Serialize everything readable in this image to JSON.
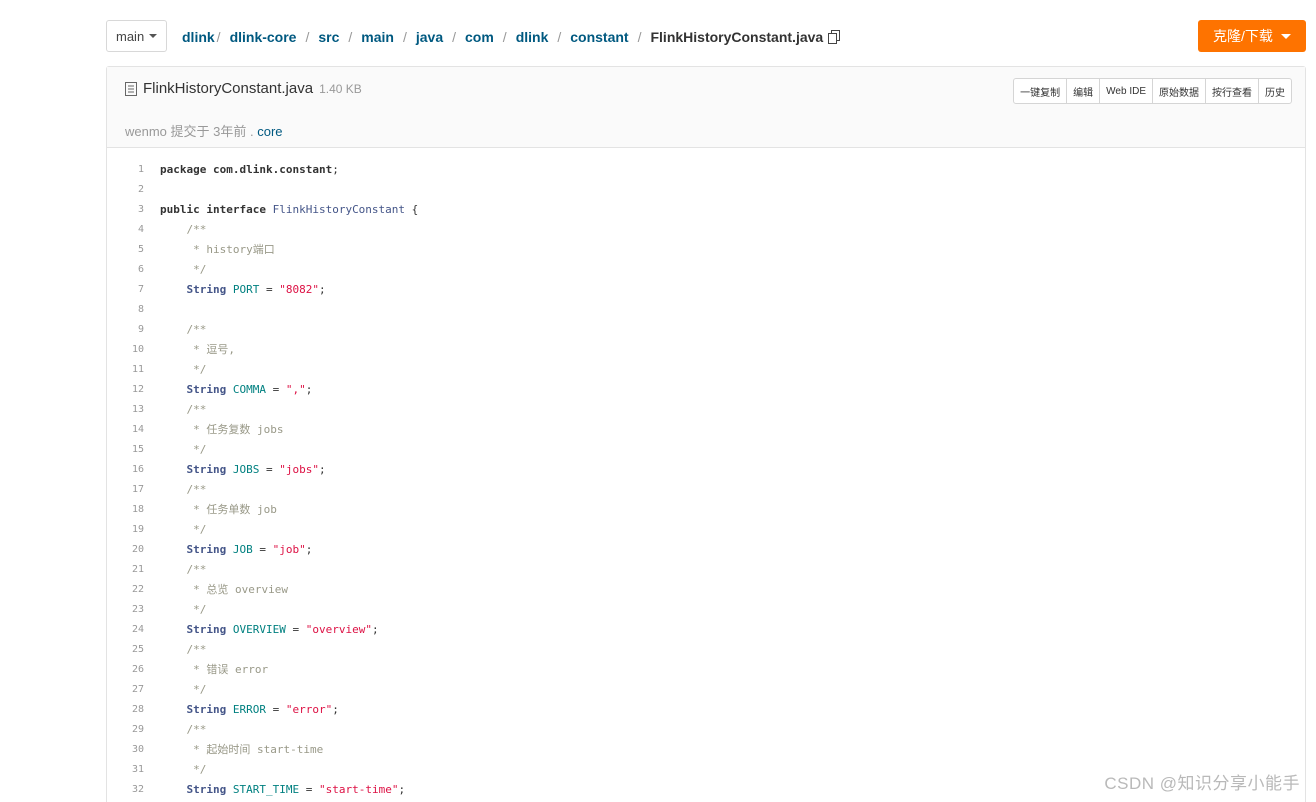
{
  "branch": {
    "label": "main"
  },
  "breadcrumb": [
    "dlink",
    "dlink-core",
    "src",
    "main",
    "java",
    "com",
    "dlink",
    "constant"
  ],
  "current_file": "FlinkHistoryConstant.java",
  "clone_button": "克隆/下载",
  "file": {
    "name": "FlinkHistoryConstant.java",
    "size": "1.40 KB",
    "commit_author": "wenmo",
    "commit_text": " 提交于 3年前 . ",
    "commit_branch": "core"
  },
  "actions": [
    "一键复制",
    "编辑",
    "Web IDE",
    "原始数据",
    "按行查看",
    "历史"
  ],
  "code_lines": [
    [
      [
        "kw",
        "package "
      ],
      [
        "kw",
        "com.dlink.constant"
      ],
      [
        "",
        "; "
      ]
    ],
    [],
    [
      [
        "kw",
        "public interface "
      ],
      [
        "cls",
        "FlinkHistoryConstant"
      ],
      [
        "",
        " {"
      ]
    ],
    [
      [
        "cm",
        "    /**"
      ]
    ],
    [
      [
        "cm",
        "     * history端口"
      ]
    ],
    [
      [
        "cm",
        "     */"
      ]
    ],
    [
      [
        "ty",
        "    String "
      ],
      [
        "id",
        "PORT"
      ],
      [
        "",
        " = "
      ],
      [
        "str",
        "\"8082\""
      ],
      [
        "",
        ";"
      ]
    ],
    [],
    [
      [
        "cm",
        "    /**"
      ]
    ],
    [
      [
        "cm",
        "     * 逗号,"
      ]
    ],
    [
      [
        "cm",
        "     */"
      ]
    ],
    [
      [
        "ty",
        "    String "
      ],
      [
        "id",
        "COMMA"
      ],
      [
        "",
        " = "
      ],
      [
        "str",
        "\",\""
      ],
      [
        "",
        ";"
      ]
    ],
    [
      [
        "cm",
        "    /**"
      ]
    ],
    [
      [
        "cm",
        "     * 任务复数 jobs"
      ]
    ],
    [
      [
        "cm",
        "     */"
      ]
    ],
    [
      [
        "ty",
        "    String "
      ],
      [
        "id",
        "JOBS"
      ],
      [
        "",
        " = "
      ],
      [
        "str",
        "\"jobs\""
      ],
      [
        "",
        ";"
      ]
    ],
    [
      [
        "cm",
        "    /**"
      ]
    ],
    [
      [
        "cm",
        "     * 任务单数 job"
      ]
    ],
    [
      [
        "cm",
        "     */"
      ]
    ],
    [
      [
        "ty",
        "    String "
      ],
      [
        "id",
        "JOB"
      ],
      [
        "",
        " = "
      ],
      [
        "str",
        "\"job\""
      ],
      [
        "",
        ";"
      ]
    ],
    [
      [
        "cm",
        "    /**"
      ]
    ],
    [
      [
        "cm",
        "     * 总览 overview"
      ]
    ],
    [
      [
        "cm",
        "     */"
      ]
    ],
    [
      [
        "ty",
        "    String "
      ],
      [
        "id",
        "OVERVIEW"
      ],
      [
        "",
        " = "
      ],
      [
        "str",
        "\"overview\""
      ],
      [
        "",
        ";"
      ]
    ],
    [
      [
        "cm",
        "    /**"
      ]
    ],
    [
      [
        "cm",
        "     * 错误 error"
      ]
    ],
    [
      [
        "cm",
        "     */"
      ]
    ],
    [
      [
        "ty",
        "    String "
      ],
      [
        "id",
        "ERROR"
      ],
      [
        "",
        " = "
      ],
      [
        "str",
        "\"error\""
      ],
      [
        "",
        ";"
      ]
    ],
    [
      [
        "cm",
        "    /**"
      ]
    ],
    [
      [
        "cm",
        "     * 起始时间 start-time"
      ]
    ],
    [
      [
        "cm",
        "     */"
      ]
    ],
    [
      [
        "ty",
        "    String "
      ],
      [
        "id",
        "START_TIME"
      ],
      [
        "",
        " = "
      ],
      [
        "str",
        "\"start-time\""
      ],
      [
        "",
        ";"
      ]
    ]
  ],
  "watermark": "CSDN @知识分享小能手"
}
